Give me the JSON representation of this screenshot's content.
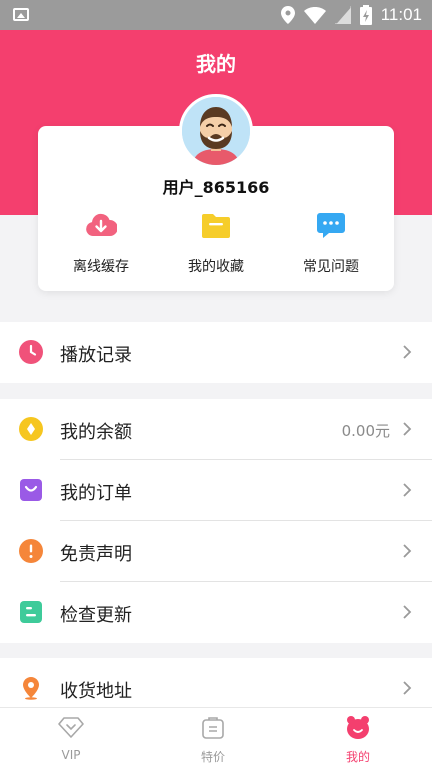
{
  "status_bar": {
    "time": "11:01"
  },
  "header": {
    "title": "我的"
  },
  "profile": {
    "username": "用户_865166",
    "quick_actions": [
      {
        "label": "离线缓存",
        "icon": "cloud-download-icon"
      },
      {
        "label": "我的收藏",
        "icon": "folder-icon"
      },
      {
        "label": "常见问题",
        "icon": "chat-bubble-icon"
      }
    ]
  },
  "menu": {
    "history": {
      "label": "播放记录",
      "icon": "clock-icon"
    },
    "balance": {
      "label": "我的余额",
      "value": "0.00元",
      "icon": "coin-icon"
    },
    "orders": {
      "label": "我的订单",
      "icon": "shopping-bag-icon"
    },
    "disclaimer": {
      "label": "免责声明",
      "icon": "exclamation-icon"
    },
    "update": {
      "label": "检查更新",
      "icon": "update-icon"
    },
    "address": {
      "label": "收货地址",
      "icon": "location-pin-icon"
    }
  },
  "tabs": [
    {
      "label": "VIP",
      "icon": "diamond-icon",
      "active": false
    },
    {
      "label": "特价",
      "icon": "bag-icon",
      "active": false
    },
    {
      "label": "我的",
      "icon": "bear-icon",
      "active": true
    }
  ],
  "colors": {
    "accent": "#f43f6e",
    "status_bar": "#9b9b9b"
  }
}
